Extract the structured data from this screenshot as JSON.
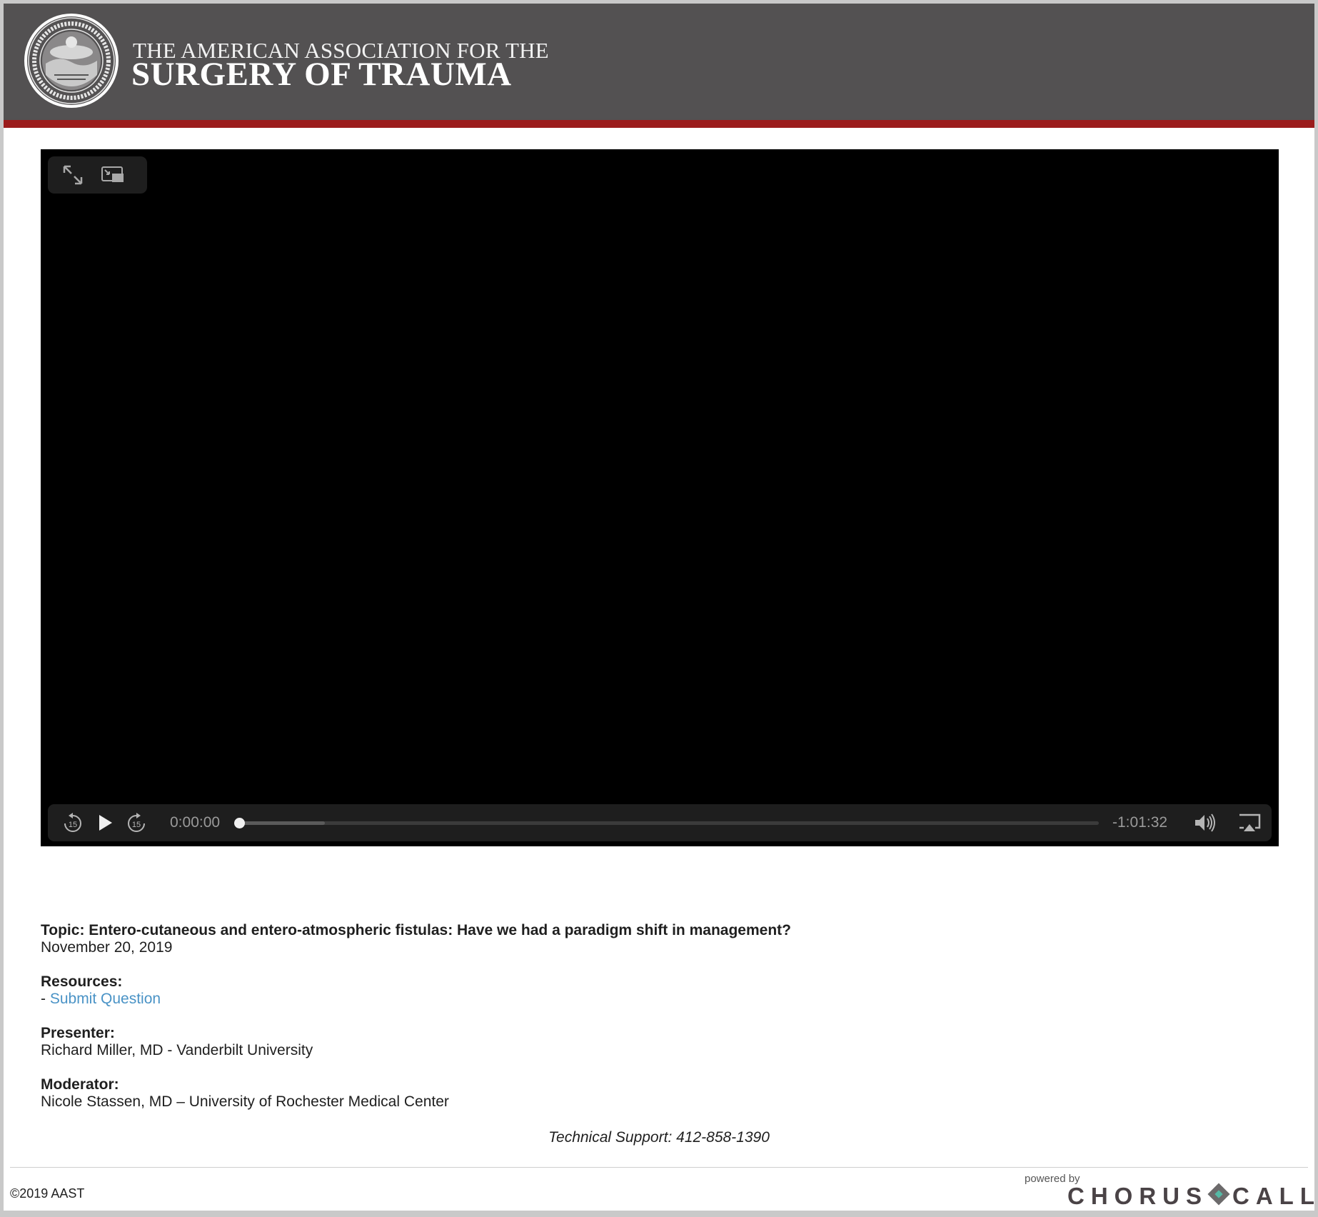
{
  "header": {
    "org_line1": "THE AMERICAN ASSOCIATION FOR THE",
    "org_line2": "SURGERY OF TRAUMA",
    "seal_icon": "aast-seal-logo",
    "seal_text": "THE AMERICAN ASSOCIATION FOR THE SURGERY OF TRAUMA",
    "background": "#535152",
    "stripe_color": "#9b1c1c"
  },
  "player": {
    "top_controls": {
      "fullscreen_icon": "fullscreen-icon",
      "pip_icon": "picture-in-picture-icon"
    },
    "bottom_controls": {
      "skip_back_icon": "skip-back-15-icon",
      "skip_back_label": "15",
      "play_icon": "play-icon",
      "skip_forward_icon": "skip-forward-15-icon",
      "skip_forward_label": "15",
      "elapsed": "0:00:00",
      "remaining": "-1:01:32",
      "progress_fraction": 0.0,
      "buffered_fraction": 0.1,
      "volume_icon": "volume-icon",
      "airplay_icon": "airplay-icon"
    }
  },
  "info": {
    "topic": "Topic: Entero-cutaneous and entero-atmospheric fistulas: Have we had a paradigm shift in management?",
    "date": "November 20, 2019",
    "resources_label": "Resources:",
    "resource_prefix": "- ",
    "submit_question": "Submit Question",
    "presenter_label": "Presenter:",
    "presenter": "Richard Miller, MD - Vanderbilt University",
    "moderator_label": "Moderator:",
    "moderator": "Nicole Stassen, MD – University of Rochester Medical Center"
  },
  "footer": {
    "support": "Technical Support: 412-858-1390",
    "copyright": "©2019 AAST",
    "powered_by": "powered by",
    "brand_part1": "CHORUS",
    "brand_part2": "CALL",
    "brand_reg": "®"
  },
  "colors": {
    "link": "#4a93c6"
  }
}
